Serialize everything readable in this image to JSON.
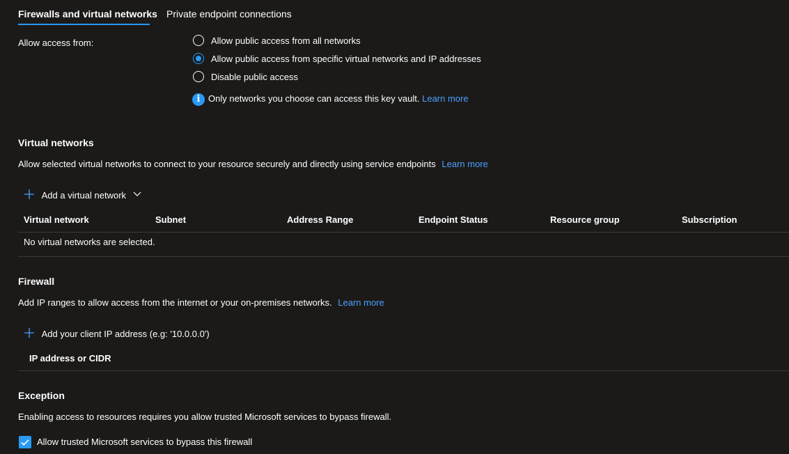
{
  "tabs": [
    {
      "label": "Firewalls and virtual networks",
      "active": true
    },
    {
      "label": "Private endpoint connections",
      "active": false
    }
  ],
  "access": {
    "label": "Allow access from:",
    "options": [
      {
        "label": "Allow public access from all networks",
        "selected": false
      },
      {
        "label": "Allow public access from specific virtual networks and IP addresses",
        "selected": true
      },
      {
        "label": "Disable public access",
        "selected": false
      }
    ],
    "info_text": "Only networks you choose can access this key vault.",
    "info_link": "Learn more"
  },
  "virtual_networks": {
    "title": "Virtual networks",
    "description": "Allow selected virtual networks to connect to your resource securely and directly using service endpoints",
    "learn_more": "Learn more",
    "add_label": "Add a virtual network",
    "columns": [
      "Virtual network",
      "Subnet",
      "Address Range",
      "Endpoint Status",
      "Resource group",
      "Subscription"
    ],
    "empty_text": "No virtual networks are selected."
  },
  "firewall": {
    "title": "Firewall",
    "description": "Add IP ranges to allow access from the internet or your on-premises networks.",
    "learn_more": "Learn more",
    "add_client_ip": "Add your client IP address (e.g: '10.0.0.0')",
    "column": "IP address or CIDR"
  },
  "exception": {
    "title": "Exception",
    "description": "Enabling access to resources requires you allow trusted Microsoft services to bypass firewall.",
    "checkbox_label": "Allow trusted Microsoft services to bypass this firewall",
    "checked": true
  },
  "colors": {
    "background": "#1b1a19",
    "accent": "#2899f5",
    "link": "#4ba0ff",
    "divider": "#3b3a39"
  }
}
